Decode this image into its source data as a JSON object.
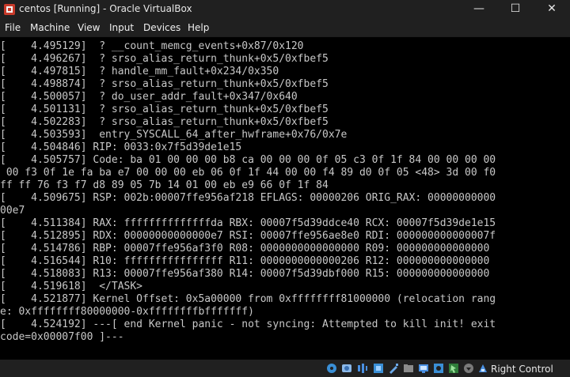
{
  "window": {
    "title": "centos [Running] - Oracle VirtualBox",
    "controls": {
      "minimize": "—",
      "maximize": "☐",
      "close": "✕"
    }
  },
  "menu": [
    "File",
    "Machine",
    "View",
    "Input",
    "Devices",
    "Help"
  ],
  "console": {
    "lines": [
      "[    4.495129]  ? __count_memcg_events+0x87/0x120",
      "[    4.496267]  ? srso_alias_return_thunk+0x5/0xfbef5",
      "[    4.497815]  ? handle_mm_fault+0x234/0x350",
      "[    4.498874]  ? srso_alias_return_thunk+0x5/0xfbef5",
      "[    4.500057]  ? do_user_addr_fault+0x347/0x640",
      "[    4.501131]  ? srso_alias_return_thunk+0x5/0xfbef5",
      "[    4.502283]  ? srso_alias_return_thunk+0x5/0xfbef5",
      "[    4.503593]  entry_SYSCALL_64_after_hwframe+0x76/0x7e",
      "[    4.504846] RIP: 0033:0x7f5d39de1e15",
      "[    4.505757] Code: ba 01 00 00 00 b8 ca 00 00 00 0f 05 c3 0f 1f 84 00 00 00 00",
      " 00 f3 0f 1e fa ba e7 00 00 00 eb 06 0f 1f 44 00 00 f4 89 d0 0f 05 <48> 3d 00 f0",
      "ff ff 76 f3 f7 d8 89 05 7b 14 01 00 eb e9 66 0f 1f 84",
      "[    4.509675] RSP: 002b:00007ffe956af218 EFLAGS: 00000206 ORIG_RAX: 00000000000",
      "00e7",
      "[    4.511384] RAX: ffffffffffffffda RBX: 00007f5d39ddce40 RCX: 00007f5d39de1e15",
      "[    4.512895] RDX: 00000000000000e7 RSI: 00007ffe956ae8e0 RDI: 000000000000007f",
      "[    4.514786] RBP: 00007ffe956af3f0 R08: 0000000000000000 R09: 000000000000000",
      "[    4.516544] R10: ffffffffffffffff R11: 0000000000000206 R12: 000000000000000",
      "[    4.518083] R13: 00007ffe956af380 R14: 00007f5d39dbf000 R15: 000000000000000",
      "[    4.519618]  </TASK>",
      "[    4.521877] Kernel Offset: 0x5a00000 from 0xffffffff81000000 (relocation rang",
      "e: 0xffffffff80000000-0xffffffffbfffffff)",
      "[    4.524192] ---[ end Kernel panic - not syncing: Attempted to kill init! exit",
      "code=0x00007f00 ]---"
    ]
  },
  "status": {
    "icons": [
      "optical-drive-icon",
      "hard-disk-icon",
      "audio-icon",
      "network-icon",
      "usb-icon",
      "shared-folder-icon",
      "display-icon",
      "recording-icon",
      "mouse-integration-icon",
      "arrow-down-icon",
      "keyboard-icon"
    ],
    "host_key": "Right Control"
  },
  "colors": {
    "console_text": "#c8c8c8",
    "console_bg": "#000000",
    "chrome_bg": "#202020"
  }
}
